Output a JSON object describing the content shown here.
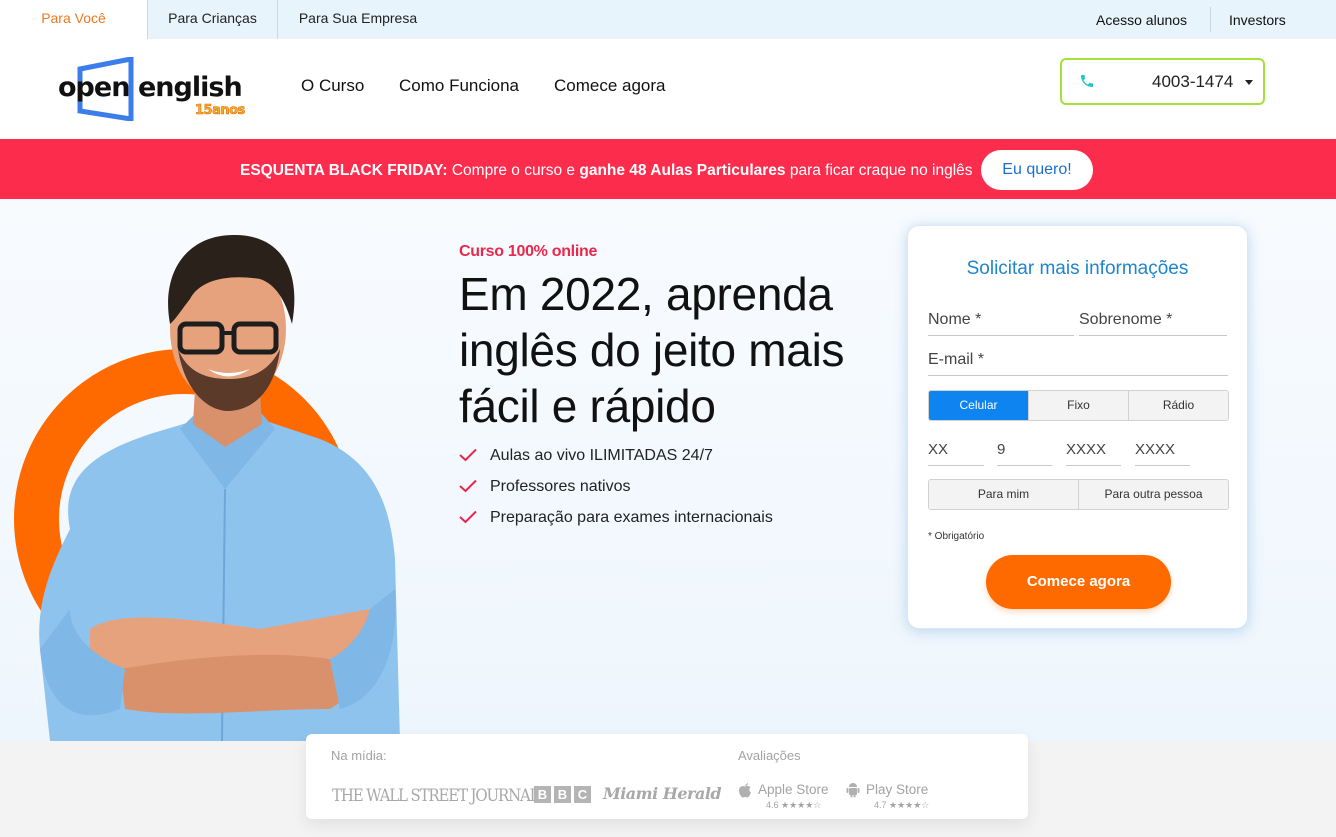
{
  "topbar": {
    "tabs": [
      {
        "label": "Para Você",
        "active": true
      },
      {
        "label": "Para Crianças",
        "active": false
      },
      {
        "label": "Para Sua Empresa",
        "active": false
      }
    ],
    "right_links": [
      "Acesso alunos",
      "Investors"
    ]
  },
  "header": {
    "logo": {
      "word1": "open",
      "word2": "english",
      "badge": "15anos"
    },
    "nav": [
      "O Curso",
      "Como Funciona",
      "Comece agora"
    ],
    "phone": {
      "icon": "phone-icon",
      "number": "4003-1474"
    }
  },
  "promo": {
    "bold_prefix": "ESQUENTA BLACK FRIDAY:",
    "text_1": " Compre o curso e ",
    "bold_mid": "ganhe 48 Aulas Particulares",
    "text_2": " para ficar craque no inglês",
    "cta": "Eu quero!"
  },
  "hero": {
    "kicker": "Curso 100% online",
    "headline": "Em 2022, aprenda inglês do jeito mais fácil e rápido",
    "bullets": [
      "Aulas ao vivo ILIMITADAS 24/7",
      "Professores nativos",
      "Preparação para exames internacionais"
    ]
  },
  "form": {
    "title": "Solicitar mais informações",
    "first_name_placeholder": "Nome *",
    "last_name_placeholder": "Sobrenome *",
    "email_placeholder": "E-mail *",
    "phone_types": [
      {
        "label": "Celular",
        "active": true
      },
      {
        "label": "Fixo",
        "active": false
      },
      {
        "label": "Rádio",
        "active": false
      }
    ],
    "phone_parts": [
      "XX",
      "9",
      "XXXX",
      "XXXX"
    ],
    "recipient": [
      "Para mim",
      "Para outra pessoa"
    ],
    "required_note": "* Obrigatório",
    "submit": "Comece agora"
  },
  "media": {
    "media_label": "Na mídia:",
    "outlets": [
      "THE WALL STREET JOURNAL.",
      "BBC",
      "Miami Herald"
    ],
    "bbc_letters": [
      "B",
      "B",
      "C"
    ],
    "reviews_label": "Avaliações",
    "stores": [
      {
        "name": "Apple Store",
        "icon": "apple-icon",
        "rating": "4.6 ★★★★☆"
      },
      {
        "name": "Play Store",
        "icon": "android-icon",
        "rating": "4.7 ★★★★☆"
      }
    ]
  },
  "colors": {
    "orange": "#ff6a00",
    "promo_red": "#fc2c4c",
    "form_blue": "#1d86cf",
    "active_tab_orange": "#ea7a23",
    "phone_border_green": "#a4e13a",
    "segment_blue": "#0d84ef"
  }
}
